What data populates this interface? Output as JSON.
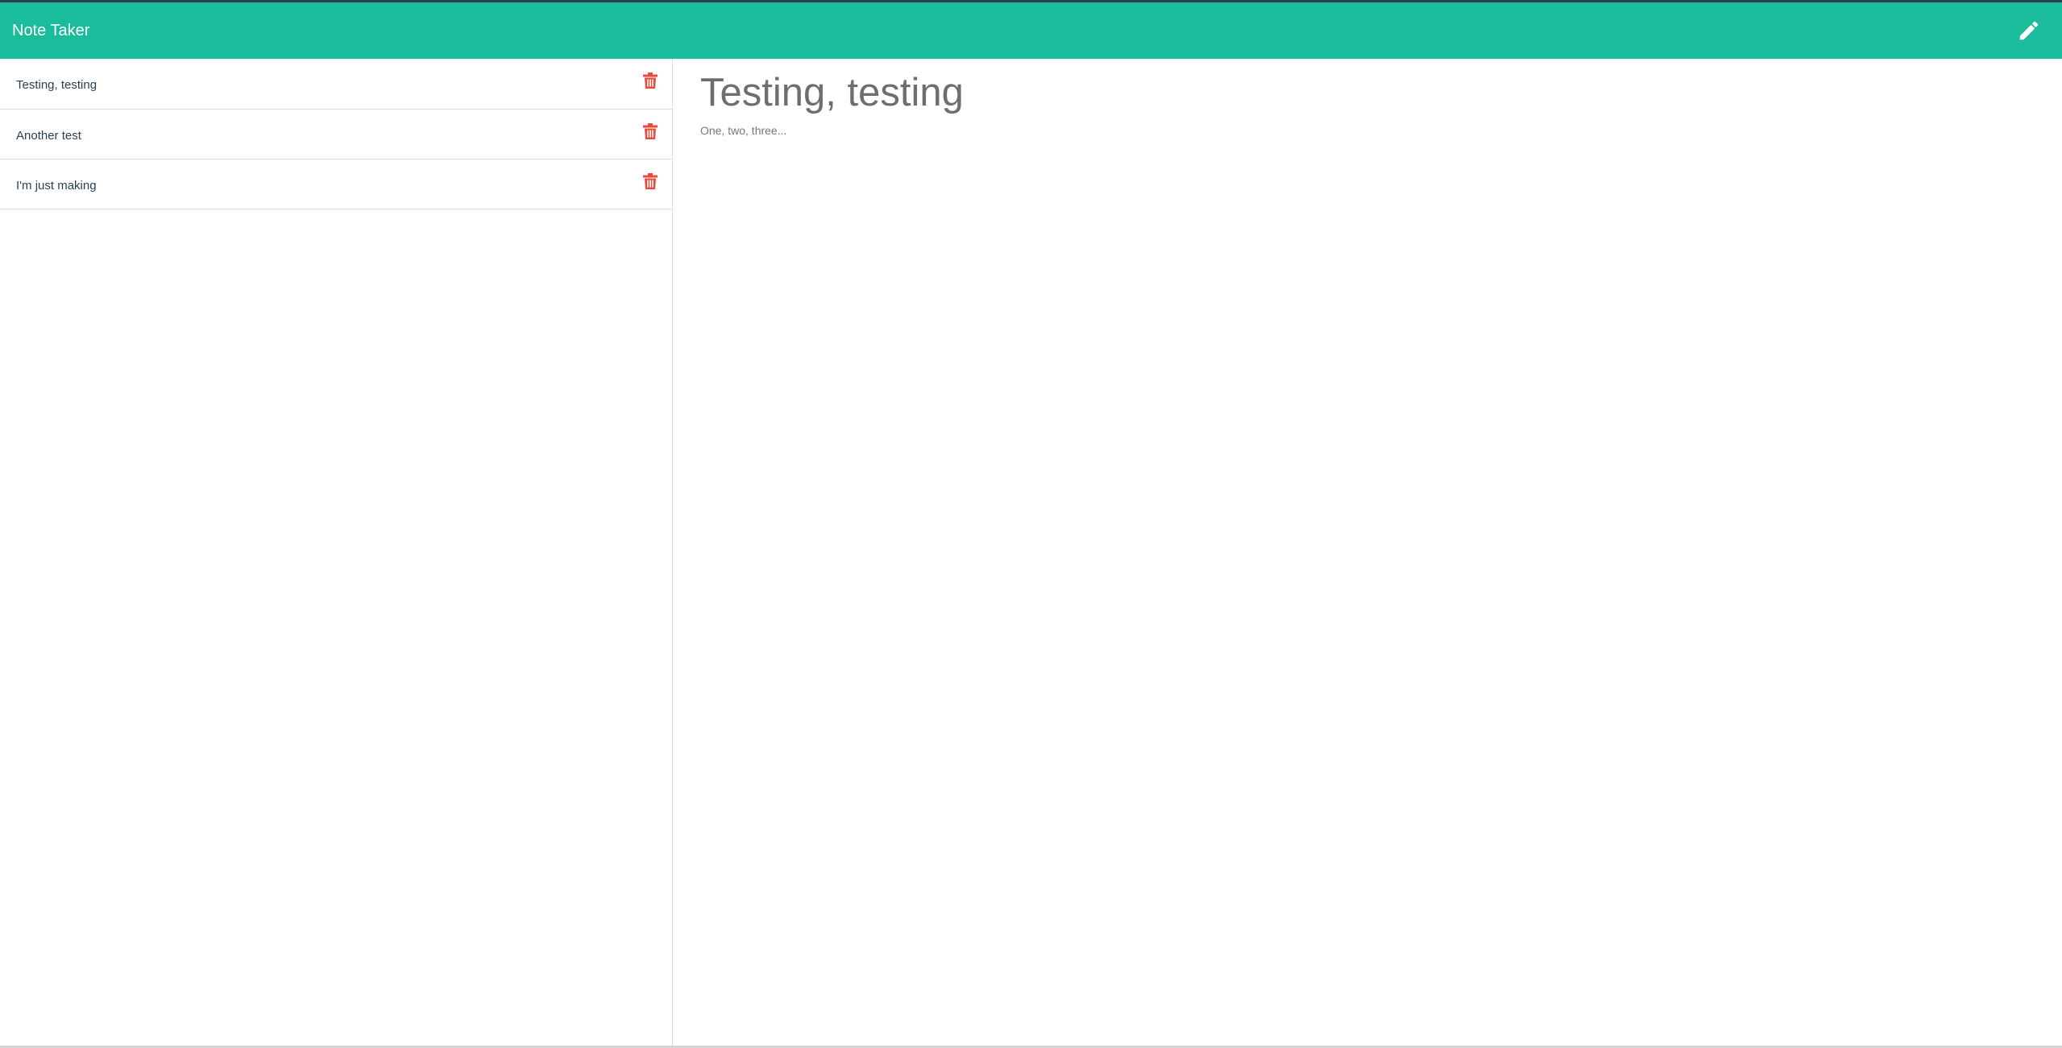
{
  "app": {
    "brand": "Note Taker",
    "accent_color": "#1abc9c",
    "delete_color": "#e74c3c"
  },
  "toolbar": {
    "new_note_icon": "pencil-icon"
  },
  "notes": [
    {
      "title": "Testing, testing",
      "icon": "trash-icon"
    },
    {
      "title": "Another test",
      "icon": "trash-icon"
    },
    {
      "title": "I'm just making",
      "icon": "trash-icon"
    }
  ],
  "active_note": {
    "title": "Testing, testing",
    "text": "One, two, three..."
  }
}
